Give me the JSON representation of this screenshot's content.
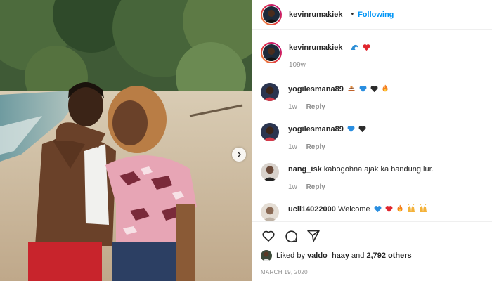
{
  "post": {
    "author": "kevinrumakiek_",
    "follow_label": "Following",
    "separator": "•"
  },
  "caption": {
    "username": "kevinrumakiek_",
    "emojis": [
      "wave-emoji",
      "red-heart-emoji"
    ],
    "time": "109w"
  },
  "comments": [
    {
      "username": "yogilesmana89",
      "text": "",
      "emojis": [
        "rowing-emoji",
        "blue-heart-emoji",
        "black-heart-emoji",
        "fire-emoji"
      ],
      "time": "1w",
      "reply_label": "Reply"
    },
    {
      "username": "yogilesmana89",
      "text": "",
      "emojis": [
        "blue-heart-emoji",
        "black-heart-emoji"
      ],
      "time": "1w",
      "reply_label": "Reply"
    },
    {
      "username": "nang_isk",
      "text": "kabogohna ajak ka bandung lur.",
      "emojis": [],
      "time": "1w",
      "reply_label": "Reply"
    },
    {
      "username": "ucil14022000",
      "text": "Welcome",
      "emojis": [
        "blue-heart-emoji",
        "red-heart-emoji",
        "fire-emoji",
        "raised-hands-emoji",
        "raised-hands-emoji"
      ],
      "time": "",
      "reply_label": ""
    }
  ],
  "likes": {
    "prefix": "Liked by",
    "user": "valdo_haay",
    "connector": "and",
    "count": "2,792 others"
  },
  "date": "MARCH 19, 2020",
  "icons": {
    "like": "heart-outline-icon",
    "comment": "comment-bubble-icon",
    "share": "paper-plane-icon",
    "next": "chevron-right-icon"
  },
  "colors": {
    "link_blue": "#0095f6",
    "secondary_text": "#8e8e8e",
    "divider": "#efefef"
  }
}
